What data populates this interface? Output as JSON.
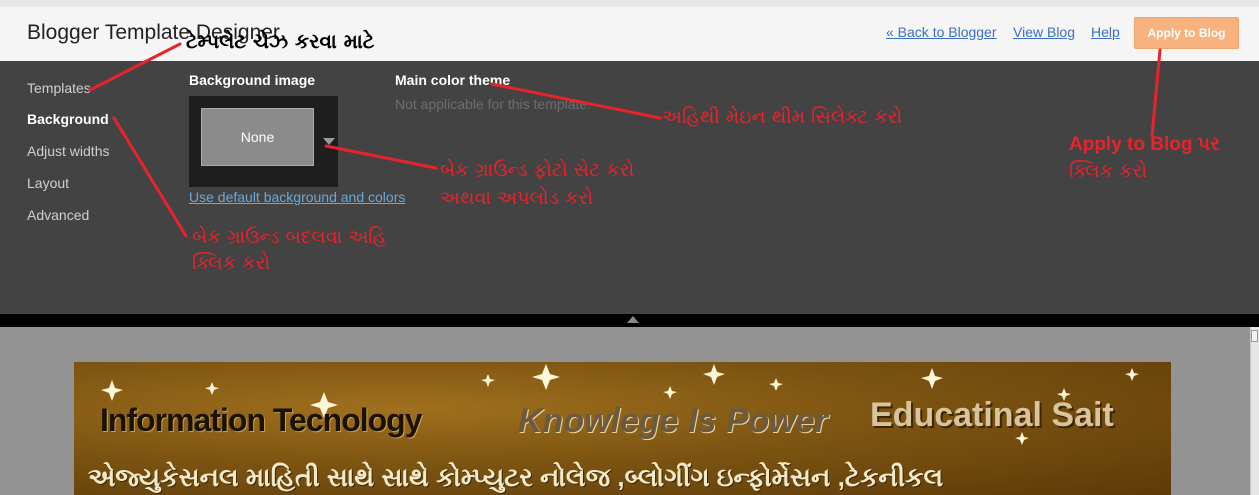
{
  "app": {
    "title": "Blogger Template Designer"
  },
  "header": {
    "back_link": "« Back to Blogger",
    "view_blog": "View Blog",
    "help": "Help",
    "apply_button": "Apply to Blog"
  },
  "sidebar": {
    "items": [
      {
        "label": "Templates",
        "active": false
      },
      {
        "label": "Background",
        "active": true
      },
      {
        "label": "Adjust widths",
        "active": false
      },
      {
        "label": "Layout",
        "active": false
      },
      {
        "label": "Advanced",
        "active": false
      }
    ]
  },
  "background": {
    "section_title": "Background image",
    "current_value": "None",
    "default_link": "Use default background and colors"
  },
  "theme": {
    "section_title": "Main color theme",
    "note": "Not applicable for this template."
  },
  "preview": {
    "banner_line1_a": "Information Tecnology",
    "banner_line1_b": "Knowlege Is Power",
    "banner_line1_c": "Educatinal Sait",
    "banner_line2": "એજ્યુકેસનલ માહિતી સાથે સાથે કોમ્પ્યુટર નોલેજ ,બ્લોગીંગ ઇન્ફોર્મેસન ,ટેકનીકલ"
  },
  "annotations": {
    "templates_note": "ટેમ્પલેટ ચેઝ કરવા માટે",
    "theme_note": "અહિથી મેઇન થીમ સિલેક્ટ કરો",
    "bg_image_note_1": "બેક ગ્રાઉન્ડ ફોટો સેટ કરો",
    "bg_image_note_2": "અથવા અપલોડ કરો",
    "background_note_1": "બેક ગ્રાઉન્ડ બદલવા અહિ",
    "background_note_2": "ક્લિક કરો",
    "apply_note_1": "Apply to Blog પર",
    "apply_note_2": "ક્લિક કરો"
  },
  "colors": {
    "accent_button": "#f7b27e",
    "panel_bg": "#434343",
    "annotation_red": "#e8232c",
    "link_blue": "#3a6fc4"
  }
}
